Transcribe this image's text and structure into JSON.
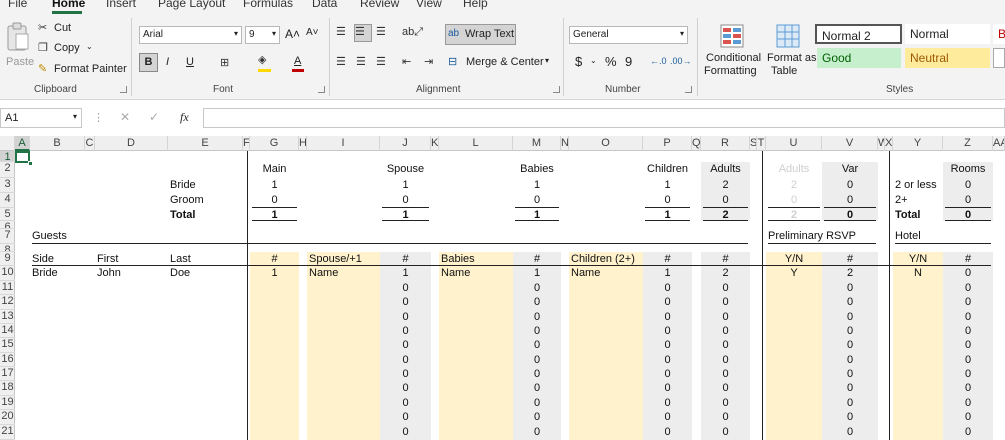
{
  "menu": {
    "tabs": [
      "File",
      "Home",
      "Insert",
      "Page Layout",
      "Formulas",
      "Data",
      "Review",
      "View",
      "Help"
    ],
    "active": "Home"
  },
  "ribbon": {
    "clipboard": {
      "group": "Clipboard",
      "paste": "Paste",
      "cut": "Cut",
      "copy": "Copy",
      "format_painter": "Format Painter"
    },
    "font": {
      "group": "Font",
      "name": "Arial",
      "size": "9",
      "bold": "B",
      "italic": "I",
      "underline": "U",
      "grow": "A˄",
      "shrink": "A˅",
      "font_color": "#c00000",
      "fill_color": "#ffd800"
    },
    "alignment": {
      "group": "Alignment",
      "wrap_text": "Wrap Text",
      "merge_center": "Merge & Center"
    },
    "number": {
      "group": "Number",
      "format": "General",
      "currency": "$",
      "percent": "%",
      "comma": "9"
    },
    "styles": {
      "group": "Styles",
      "conditional_formatting": [
        "Conditional",
        "Formatting"
      ],
      "format_as_table": [
        "Format as",
        "Table"
      ],
      "cells": [
        {
          "label": "Normal 2",
          "bg": "#ffffff",
          "color": "#111111"
        },
        {
          "label": "Normal",
          "bg": "#ffffff",
          "color": "#111111"
        },
        {
          "label": "Good",
          "bg": "#c6efce",
          "color": "#006100"
        },
        {
          "label": "Neutral",
          "bg": "#ffeb9c",
          "color": "#9c5700"
        }
      ]
    }
  },
  "formula_bar": {
    "name_box": "A1",
    "fx": "fx",
    "cancel": "✕",
    "enter": "✓",
    "value": ""
  },
  "columns": [
    "A",
    "B",
    "C",
    "D",
    "E",
    "F",
    "G",
    "H",
    "I",
    "J",
    "K",
    "L",
    "M",
    "N",
    "O",
    "P",
    "Q",
    "R",
    "S",
    "T",
    "U",
    "V",
    "W",
    "X",
    "Y",
    "Z",
    "AA"
  ],
  "rows": [
    "1",
    "2",
    "3",
    "4",
    "5",
    "6",
    "7",
    "8",
    "9",
    "10",
    "11",
    "12",
    "13",
    "14",
    "15",
    "16",
    "17",
    "18",
    "19",
    "20",
    "21"
  ],
  "summary": {
    "headers": {
      "main": "Main",
      "spouse": "Spouse",
      "babies": "Babies",
      "children": "Children",
      "adults": "Adults",
      "adults_prelim": "Adults",
      "var": "Var",
      "rooms": "Rooms"
    },
    "row_labels": [
      "Bride",
      "Groom",
      "Total"
    ],
    "main": [
      1,
      0,
      1
    ],
    "spouse": [
      1,
      0,
      1
    ],
    "babies": [
      1,
      0,
      1
    ],
    "children": [
      1,
      0,
      1
    ],
    "adults": [
      2,
      0,
      2
    ],
    "adults_prelim": [
      2,
      0,
      2
    ],
    "var": [
      0,
      0,
      0
    ],
    "hotel_labels": [
      "2 or less",
      "2+",
      "Total"
    ],
    "rooms": [
      0,
      0,
      0
    ]
  },
  "sections": {
    "guests": "Guests",
    "prelim": "Preliminary RSVP",
    "hotel": "Hotel"
  },
  "guest_headers": {
    "side": "Side",
    "first": "First",
    "last": "Last",
    "main_count": "#",
    "spouse": "Spouse/+1",
    "spouse_count": "#",
    "babies": "Babies",
    "babies_count": "#",
    "children": "Children (2+)",
    "children_count": "#",
    "adults_count": "#",
    "yn": "Y/N",
    "var_count": "#",
    "hotel_yn": "Y/N",
    "rooms_count": "#"
  },
  "guests": [
    {
      "side": "Bride",
      "first": "John",
      "last": "Doe",
      "main": "1",
      "spouse": "Name",
      "spouse_n": "1",
      "babies": "Name",
      "babies_n": "1",
      "children": "Name",
      "children_n": "1",
      "adults": "2",
      "yn": "Y",
      "var": "2",
      "hotel_yn": "N",
      "rooms": "0"
    }
  ],
  "empty_row_value": "0"
}
